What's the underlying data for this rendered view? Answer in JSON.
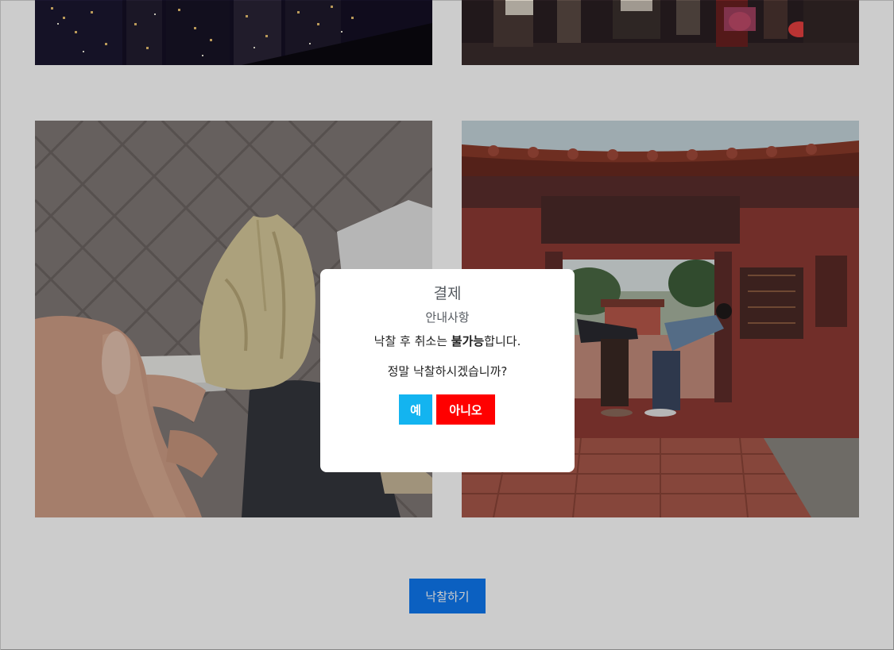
{
  "gallery": {
    "photos": [
      {
        "icon": "city-night-photo"
      },
      {
        "icon": "night-street-crowd-photo"
      },
      {
        "icon": "dumpling-on-spoon-photo"
      },
      {
        "icon": "temple-gate-couple-photo"
      }
    ]
  },
  "bid_button_label": "낙찰하기",
  "modal": {
    "title": "결제",
    "subtitle": "안내사항",
    "notice_prefix": "낙찰 후 취소는 ",
    "notice_bold": "불가능",
    "notice_suffix": "합니다.",
    "question": "정말 낙찰하시겠습니까?",
    "yes_label": "예",
    "no_label": "아니오"
  },
  "colors": {
    "bid_button": "#0e78f2",
    "yes_button": "#13b4f0",
    "no_button": "#ff0000",
    "overlay": "rgba(0,0,0,0.2)"
  }
}
